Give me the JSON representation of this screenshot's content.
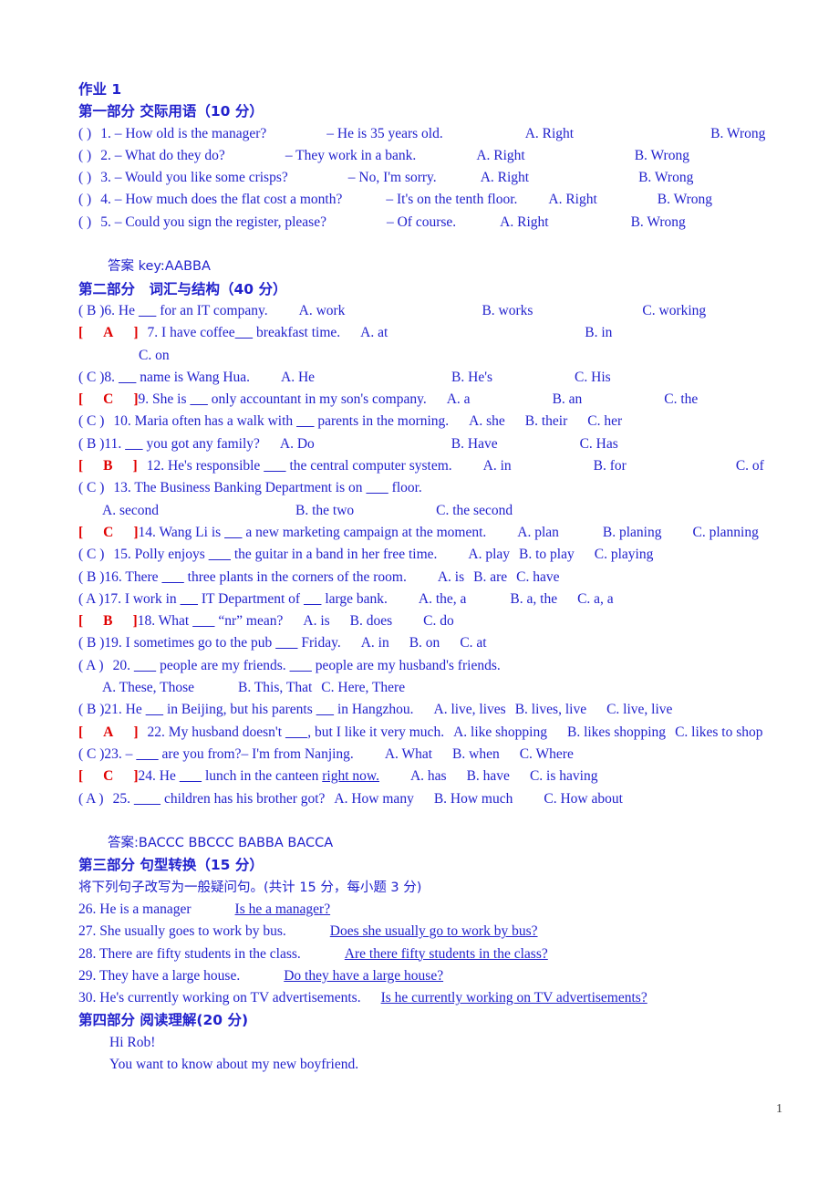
{
  "document": {
    "title": "作业 1",
    "page_number": "1",
    "text_color": "#2222cc",
    "answer_color": "#e00000"
  },
  "part1": {
    "heading": "第一部分 交际用语（10 分）",
    "questions": [
      {
        "mark": "(      )",
        "num": "1.",
        "prompt": "– How old is the manager?",
        "reply": "– He is 35 years old.",
        "optionA": "A. Right",
        "optionB": "B. Wrong"
      },
      {
        "mark": "(    )",
        "num": "2.",
        "prompt": "– What do they do?",
        "reply": "– They work in a bank.",
        "optionA": "A. Right",
        "optionB": "B. Wrong"
      },
      {
        "mark": "(  )",
        "num": "3.",
        "prompt": "– Would you like some crisps?",
        "reply": "– No, I'm sorry.",
        "optionA": "A. Right",
        "optionB": "B. Wrong"
      },
      {
        "mark": "(    )",
        "num": "4.",
        "prompt": "– How much does the flat cost a month?",
        "reply": "– It's on the tenth floor.",
        "optionA": "A. Right",
        "optionB": "B. Wrong"
      },
      {
        "mark": "(    )",
        "num": "5.",
        "prompt": "– Could you sign the register, please?",
        "reply": "– Of course.",
        "optionA": "A. Right",
        "optionB": "B. Wrong"
      }
    ],
    "answer_key": "答案 key:AABBA"
  },
  "part2": {
    "heading": "第二部分　词汇与结构（40 分）",
    "q6": {
      "mark": "( B )",
      "num": "6.",
      "stem_a": "He ",
      "stem_b": " for an IT company.",
      "a": "A. work",
      "b": "B. works",
      "c": "C. working"
    },
    "q7": {
      "open": "[",
      "ans": "A",
      "close": "]",
      "num": "7.",
      "stem_a": "I have coffee",
      "stem_b": " breakfast time.",
      "a": "A. at",
      "b": "B. in",
      "c": "C. on"
    },
    "q8": {
      "mark": "( C )",
      "num": "8.",
      "stem_a": "",
      "stem_b": " name is Wang Hua.",
      "a": "A. He",
      "b": "B. He's",
      "c": "C. His"
    },
    "q9": {
      "open": "[",
      "ans": "C",
      "close": "]",
      "num": "9.",
      "stem_a": "She is ",
      "stem_b": " only accountant in my son's company.",
      "a": "A. a",
      "b": "B. an",
      "c": "C. the"
    },
    "q10": {
      "mark": "(   C )",
      "num": "10.",
      "stem_a": "Maria often has a walk with ",
      "stem_b": " parents in the morning.",
      "a": "A. she",
      "b": "B. their",
      "c": "C. her"
    },
    "q11": {
      "mark": "( B   )",
      "num": "11.",
      "stem_a": "",
      "stem_b": " you got any family?",
      "a": "A. Do",
      "b": "B. Have",
      "c": "C. Has"
    },
    "q12": {
      "open": "[",
      "ans": "B",
      "close": "]",
      "num": "12.",
      "stem_a": "He's responsible ",
      "stem_b": " the central computer system.",
      "a": "A. in",
      "b": "B. for",
      "c": "C. of"
    },
    "q13": {
      "mark": "( C   )",
      "num": "13.",
      "stem_a": "The Business Banking Department is on ",
      "stem_b": " floor.",
      "a": "A. second",
      "b": "B. the two",
      "c": "C. the second"
    },
    "q14": {
      "open": "[",
      "ans": "C",
      "close": "]",
      "num": "14.",
      "stem_a": "Wang Li is ",
      "stem_b": " a new marketing campaign at the moment.",
      "a": "A. plan",
      "b": "B. planing",
      "c": "C. planning"
    },
    "q15": {
      "mark": "( C   )",
      "num": "15.",
      "stem_a": "Polly enjoys ",
      "stem_b": " the guitar in a band in her free time.",
      "a": "A. play",
      "b": "B. to play",
      "c": "C. playing"
    },
    "q16": {
      "mark": "( B )",
      "num": "16.",
      "stem_a": "There ",
      "stem_b": " three plants in the corners of the room.",
      "a": "A. is",
      "b": "B. are",
      "c": "C. have"
    },
    "q17": {
      "mark": "( A )",
      "num": "17.",
      "stem_a": "I work in ",
      "stem_b": " IT Department of ",
      "stem_c": " large bank.",
      "a": "A. the, a",
      "b": "B. a, the",
      "c": "C. a, a"
    },
    "q18": {
      "open": "[",
      "ans": "B",
      "close": "]",
      "num": "18.",
      "stem_a": "What ",
      "stem_b": " “nr” mean?",
      "a": "A. is",
      "b": "B. does",
      "c": "C. do"
    },
    "q19": {
      "mark": "( B )",
      "num": "19.",
      "stem_a": "I sometimes go to the pub ",
      "stem_b": " Friday.",
      "a": "A. in",
      "b": "B. on",
      "c": "C. at"
    },
    "q20": {
      "mark": "( A   )",
      "num": "20.",
      "stem_a": "",
      "stem_b": " people are my friends. ",
      "stem_c": " people are my husband's friends.",
      "a": "A. These, Those",
      "b": "B. This, That",
      "c": "C. Here, There"
    },
    "q21": {
      "mark": "( B   )",
      "num": "21.",
      "stem_a": "He ",
      "stem_b": " in Beijing, but his parents ",
      "stem_c": " in Hangzhou.",
      "a": "A. live, lives",
      "b": "B. lives, live",
      "c": "C. live, live"
    },
    "q22": {
      "open": "[",
      "ans": "A",
      "close": "]",
      "num": "22.",
      "stem_a": "My husband doesn't ",
      "stem_b": ", but I like it very much.",
      "a": "A. like shopping",
      "b": "B. likes shopping",
      "c": "C. likes to shop"
    },
    "q23": {
      "mark": "( C )",
      "num": "23.",
      "stem_a": "– ",
      "stem_b": " are you from?– I'm from Nanjing.",
      "a": "A. What",
      "b": "B. when",
      "c": "C. Where"
    },
    "q24": {
      "open": "[",
      "ans": "C",
      "close": "]",
      "num": "24.",
      "stem_a": "He ",
      "stem_b": " lunch in the canteen ",
      "underlined": "right now.",
      "a": "A. has",
      "b": "B. have",
      "c": "C. is having"
    },
    "q25": {
      "mark": "( A   )",
      "num": "25.",
      "stem_a": "",
      "stem_b": " children has his brother got?",
      "a": "A. How many",
      "b": "B. How much",
      "c": "C. How about"
    },
    "answer_key": "答案:BACCC   BBCCC    BABBA BACCA"
  },
  "part3": {
    "heading": "第三部分 句型转换（15 分）",
    "instruction": "将下列句子改写为一般疑问句。(共计 15 分，每小题 3 分)",
    "items": [
      {
        "num": "26.",
        "original": "He is a manager",
        "answer": "Is he a manager?"
      },
      {
        "num": "27.",
        "original": "She usually goes to work by bus.",
        "answer": "Does she usually go to work by bus?"
      },
      {
        "num": "28.",
        "original": "There are fifty students in the class.",
        "answer": "Are there fifty students in the class?"
      },
      {
        "num": "29.",
        "original": "They have a large house.",
        "answer": "Do they have a large house?"
      },
      {
        "num": "30.",
        "original": "He's currently working on TV advertisements.",
        "answer": "Is he currently working on TV advertisements?"
      }
    ]
  },
  "part4": {
    "heading": "第四部分 阅读理解(20 分)",
    "lines": [
      "Hi Rob!",
      "You want to know about my new boyfriend."
    ]
  }
}
